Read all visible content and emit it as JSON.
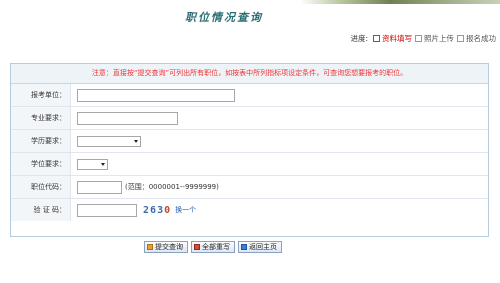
{
  "header": {
    "title": "职位情况查询"
  },
  "progress": {
    "label": "进度:",
    "steps": [
      {
        "label": "资料填写",
        "active": true
      },
      {
        "label": "照片上传",
        "active": false
      },
      {
        "label": "报名成功",
        "active": false
      }
    ]
  },
  "form": {
    "notice": "注意：直接按“提交查询”可列出所有职位，如按表中所列指标项设定条件，可查询您想要报考的职位。",
    "fields": {
      "unit": {
        "label": "报考单位：",
        "value": ""
      },
      "major": {
        "label": "专业要求：",
        "value": ""
      },
      "education": {
        "label": "学历要求：",
        "selected": ""
      },
      "degree": {
        "label": "学位要求：",
        "selected": ""
      },
      "position_code": {
        "label": "职位代码：",
        "value": "",
        "hint": "(范围：0000001--9999999)"
      },
      "captcha": {
        "label": "验 证 码：",
        "value": "",
        "code": [
          "2",
          "6",
          "3",
          "0"
        ],
        "change_link": "换一个"
      }
    }
  },
  "buttons": {
    "submit": "提交查询",
    "reset": "全部重写",
    "home": "返回主页"
  }
}
